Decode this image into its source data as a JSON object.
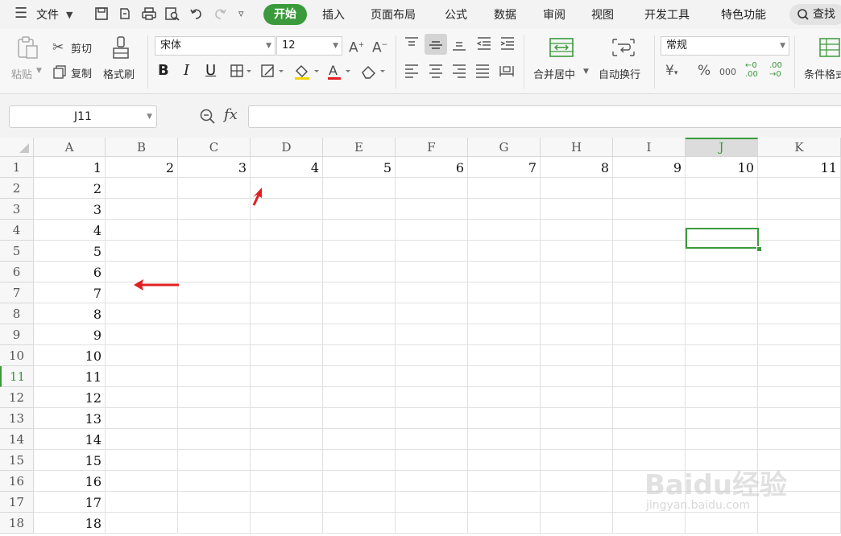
{
  "menu": {
    "file_label": "文件",
    "tabs": [
      "开始",
      "插入",
      "页面布局",
      "公式",
      "数据",
      "审阅",
      "视图",
      "开发工具",
      "特色功能"
    ],
    "active_tab": "开始",
    "search_label": "查找"
  },
  "ribbon": {
    "paste_label": "粘贴",
    "cut_label": "剪切",
    "copy_label": "复制",
    "format_painter_label": "格式刷",
    "font_name": "宋体",
    "font_size": "12",
    "merge_center_label": "合并居中",
    "wrap_text_label": "自动换行",
    "number_format": "常规",
    "conditional_format_label": "条件格式"
  },
  "formula_bar": {
    "name_box": "J11",
    "fx_label": "fx",
    "formula": ""
  },
  "sheet": {
    "columns": [
      "A",
      "B",
      "C",
      "D",
      "E",
      "F",
      "G",
      "H",
      "I",
      "J",
      "K"
    ],
    "selected_column": "J",
    "rows": [
      "1",
      "2",
      "3",
      "4",
      "5",
      "6",
      "7",
      "8",
      "9",
      "10",
      "11",
      "12",
      "13",
      "14",
      "15",
      "16",
      "17",
      "18"
    ],
    "selected_row": "11",
    "row1_values": [
      "1",
      "2",
      "3",
      "4",
      "5",
      "6",
      "7",
      "8",
      "9",
      "10",
      "11"
    ],
    "colA_values": [
      "1",
      "2",
      "3",
      "4",
      "5",
      "6",
      "7",
      "8",
      "9",
      "10",
      "11",
      "12",
      "13",
      "14",
      "15",
      "16",
      "17",
      "18"
    ],
    "active_cell": "J11"
  },
  "watermark": {
    "text": "Baidu经验",
    "url_text": "jingyan.baidu.com"
  },
  "colors": {
    "accent": "#3b9a3b",
    "arrow": "#e02020"
  }
}
